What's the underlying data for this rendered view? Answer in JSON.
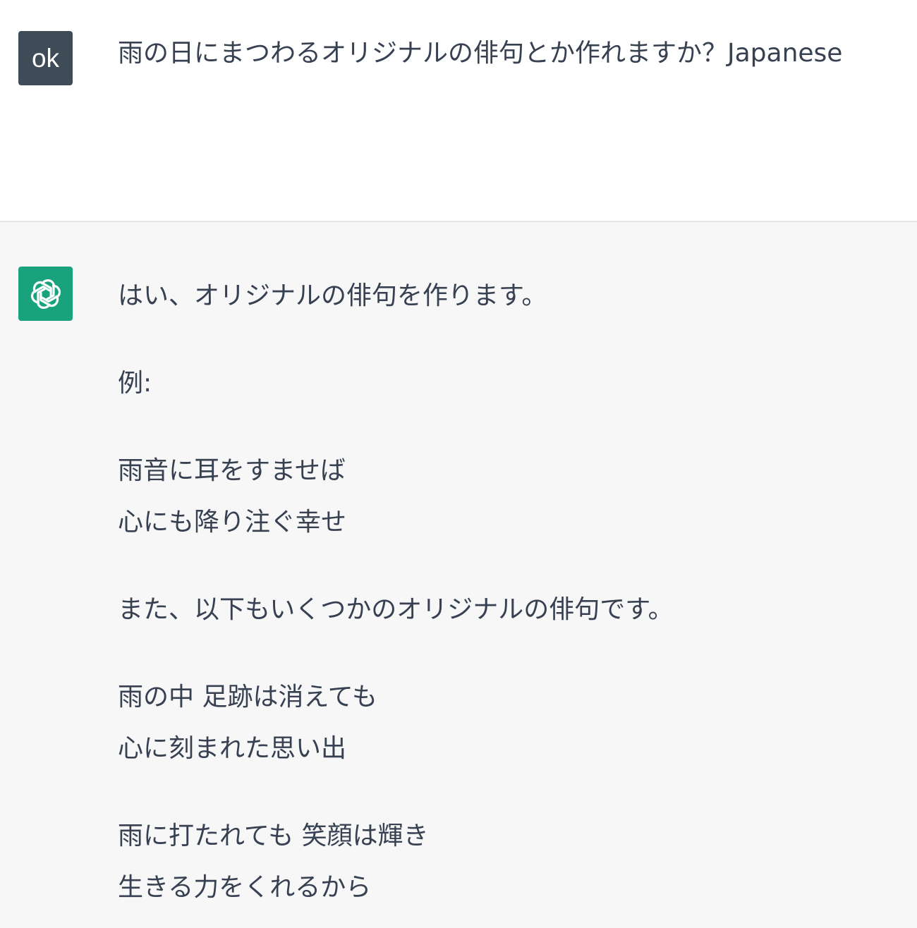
{
  "conversation": {
    "user": {
      "avatar_label": "ok",
      "message": "雨の日にまつわるオリジナルの俳句とか作れますか？Japanese"
    },
    "assistant": {
      "avatar_icon": "openai-logo-icon",
      "intro": "はい、オリジナルの俳句を作ります。",
      "example_label": "例:",
      "haiku_1": {
        "line1": "雨音に耳をすませば",
        "line2": "心にも降り注ぐ幸せ"
      },
      "more_intro": "また、以下もいくつかのオリジナルの俳句です。",
      "haiku_2": {
        "line1": "雨の中 足跡は消えても",
        "line2": "心に刻まれた思い出"
      },
      "haiku_3": {
        "line1": "雨に打たれても 笑顔は輝き",
        "line2": "生きる力をくれるから"
      }
    }
  },
  "colors": {
    "user_avatar_bg": "#3f4b56",
    "assistant_avatar_bg": "#19a37d",
    "assistant_message_bg": "#f7f7f8",
    "text": "#374151"
  }
}
